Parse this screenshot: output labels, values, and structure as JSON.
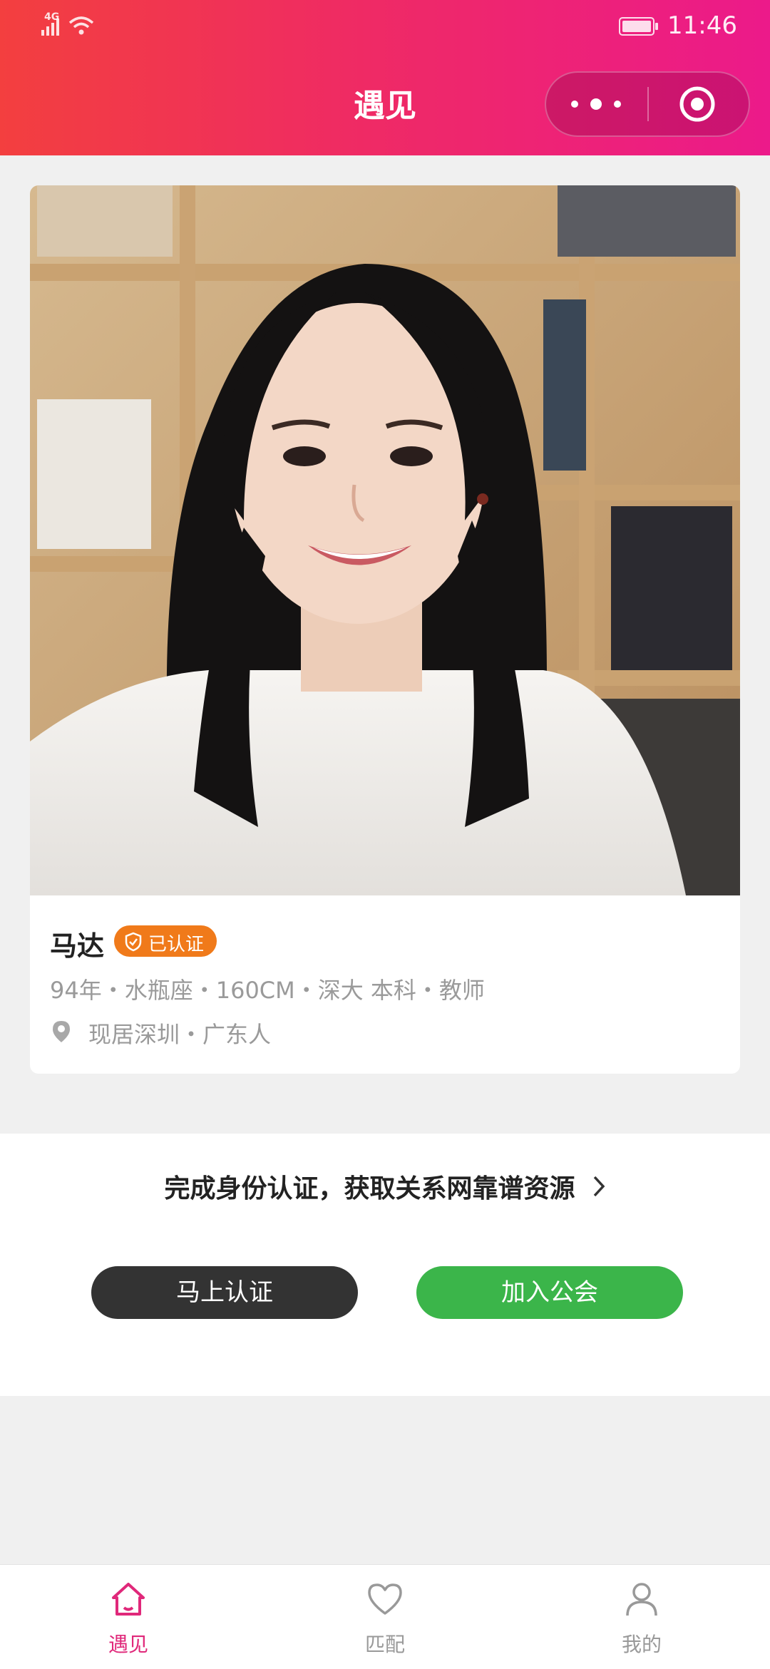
{
  "status_bar": {
    "network": "4G",
    "time": "11:46"
  },
  "header": {
    "title": "遇见",
    "capsule": {
      "more_icon": "more-dots-icon",
      "close_icon": "target-circle-icon"
    }
  },
  "profile": {
    "name": "马达",
    "verified_badge": "已认证",
    "info": "94年・水瓶座・160CM・深大 本科・教师",
    "location": "现居深圳・广东人"
  },
  "verify_section": {
    "promo_text": "完成身份认证，获取关系网靠谱资源",
    "verify_button": "马上认证",
    "join_button": "加入公会"
  },
  "tabbar": {
    "tabs": [
      {
        "label": "遇见",
        "icon": "home-icon",
        "active": true
      },
      {
        "label": "匹配",
        "icon": "heart-icon",
        "active": false
      },
      {
        "label": "我的",
        "icon": "user-icon",
        "active": false
      }
    ]
  },
  "colors": {
    "header_gradient_start": "#f33f3f",
    "header_gradient_end": "#ec1a8a",
    "badge": "#f07a1a",
    "verify_button": "#333333",
    "join_button": "#3bb54a",
    "tab_active": "#e0287a"
  }
}
